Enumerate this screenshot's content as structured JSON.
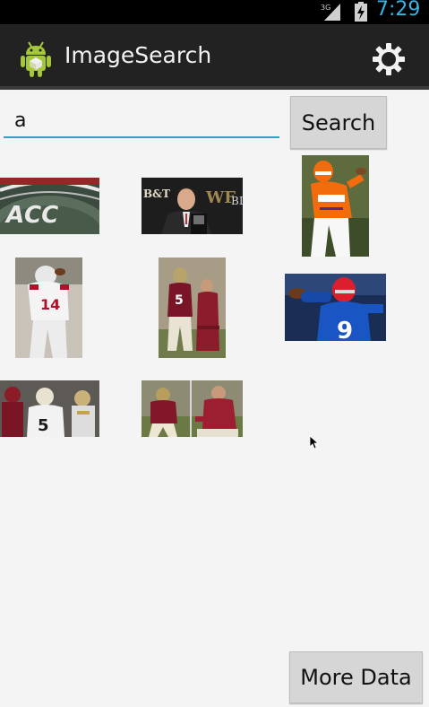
{
  "status_bar": {
    "network": "3G",
    "time": "7:29"
  },
  "action_bar": {
    "title": "ImageSearch"
  },
  "search": {
    "query": "a",
    "button_label": "Search"
  },
  "results": [
    {
      "icon": "acc-field-image"
    },
    {
      "icon": "press-conference-image"
    },
    {
      "icon": "orange-quarterback-image"
    },
    {
      "icon": "red-player-image"
    },
    {
      "icon": "players-sideline-image"
    },
    {
      "icon": "blue-quarterback-image"
    },
    {
      "icon": "players-crowd-image"
    },
    {
      "icon": "red-team-collage-image"
    }
  ],
  "more_button_label": "More Data",
  "colors": {
    "accent": "#33b5e5",
    "action_bar": "#222222",
    "input_underline": "#3a9fbf"
  }
}
